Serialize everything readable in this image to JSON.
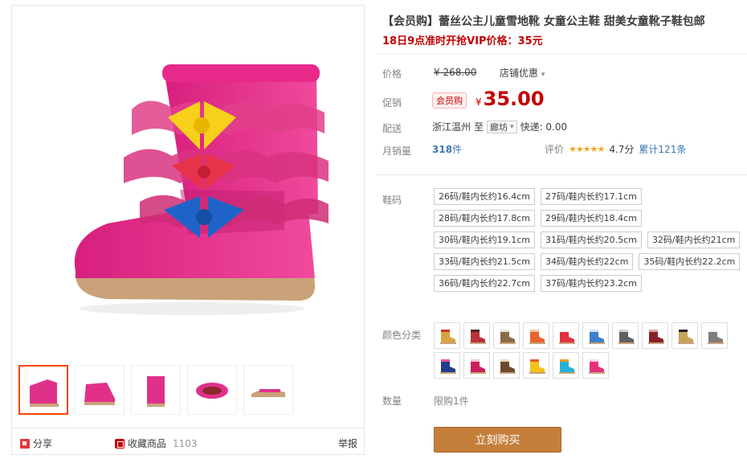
{
  "product": {
    "title": "【会员购】蕾丝公主儿童雪地靴 女童公主鞋 甜美女童靴子鞋包邮",
    "subtitle": "18日9点准时开抢VIP价格：35元"
  },
  "price": {
    "label": "价格",
    "original": "¥ 268.00",
    "shop_discount": "店铺优惠",
    "promo_label": "促销",
    "member_badge": "会员购",
    "promo_currency": "¥",
    "promo_value": "35.00"
  },
  "shipping": {
    "label": "配送",
    "from": "浙江温州",
    "to_word": "至",
    "city": "廊坊",
    "express": "快递: 0.00"
  },
  "sales": {
    "label": "月销量",
    "count": "318",
    "unit": "件",
    "rating_label": "评价",
    "stars": "★★★★★",
    "score": "4.7分",
    "reviews": "累计121条"
  },
  "sizes": {
    "label": "鞋码",
    "options": [
      "26码/鞋内长约16.4cm",
      "27码/鞋内长约17.1cm",
      "28码/鞋内长约17.8cm",
      "29码/鞋内长约18.4cm",
      "30码/鞋内长约19.1cm",
      "31码/鞋内长约20.5cm",
      "32码/鞋内长约21cm",
      "33码/鞋内长约21.5cm",
      "34码/鞋内长约22cm",
      "35码/鞋内长约22.2cm",
      "36码/鞋内长约22.7cm",
      "37码/鞋内长约23.2cm"
    ]
  },
  "colors": {
    "label": "颜色分类",
    "swatches": [
      {
        "body": "#d9a441",
        "accent": "#c23a2a"
      },
      {
        "body": "#b8323a",
        "accent": "#4a2b23"
      },
      {
        "body": "#8a6a4a",
        "accent": "#e8e2d8"
      },
      {
        "body": "#e9642e",
        "accent": "#f2c2a2"
      },
      {
        "body": "#e0333f",
        "accent": "#ffffff"
      },
      {
        "body": "#3a80c8",
        "accent": "#d0e4f6"
      },
      {
        "body": "#606060",
        "accent": "#cfcfcf"
      },
      {
        "body": "#8a1f2a",
        "accent": "#d7a5a5"
      },
      {
        "body": "#c8a35a",
        "accent": "#222222"
      },
      {
        "body": "#7d7d7d",
        "accent": "#f4f4f4"
      },
      {
        "body": "#1e3d8f",
        "accent": "#ff4d8d"
      },
      {
        "body": "#c71f5b",
        "accent": "#f3c4d6"
      },
      {
        "body": "#6b4a2f",
        "accent": "#e6d7bd"
      },
      {
        "body": "#f0c21a",
        "accent": "#e65d27"
      },
      {
        "body": "#26b3d8",
        "accent": "#f29a1f"
      },
      {
        "body": "#e4307b",
        "accent": "#ffd1e3"
      }
    ]
  },
  "quantity": {
    "label": "数量",
    "limit": "限购1件"
  },
  "buy_button": "立刻购买",
  "share": {
    "share_label": "分享",
    "fav_label": "收藏商品",
    "fav_count": "1103",
    "report_label": "举报"
  },
  "colors_theme": {
    "accent_red": "#c40000",
    "buy_button": "#c47f3a",
    "link_blue": "#3c76b5",
    "boot_pink": "#e0318a"
  }
}
